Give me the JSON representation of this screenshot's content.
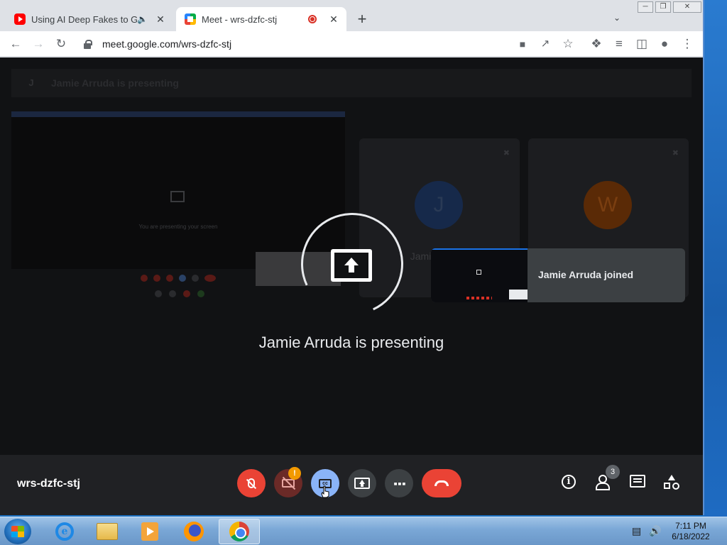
{
  "browser": {
    "tabs": [
      {
        "title": "Using AI Deep Fakes to Get F",
        "favicon": "youtube-icon",
        "audio": "speaker-icon"
      },
      {
        "title": "Meet - wrs-dzfc-stj",
        "favicon": "meet-icon",
        "recording": "record-icon"
      }
    ],
    "url": "meet.google.com/wrs-dzfc-stj"
  },
  "meet": {
    "header": {
      "avatar": "J",
      "label": "Jamie Arruda is presenting"
    },
    "ghost_screen_text": "You are presenting your screen",
    "tiles": [
      {
        "avatar": "J",
        "label": "Jamie Arruda",
        "color": "#174ea6"
      },
      {
        "avatar": "W",
        "label": "",
        "color": "#e8710a"
      }
    ],
    "overlay_text": "Jamie Arruda is presenting",
    "toast": {
      "message": "Jamie Arruda joined"
    },
    "meeting_code": "wrs-dzfc-stj",
    "participant_count": "3",
    "camera_warning": "!"
  },
  "taskbar": {
    "time": "7:11 PM",
    "date": "6/18/2022"
  },
  "colors": {
    "hangup_red": "#ea4335",
    "captions_active": "#8ab4f8",
    "control_dark": "#3c4043"
  }
}
